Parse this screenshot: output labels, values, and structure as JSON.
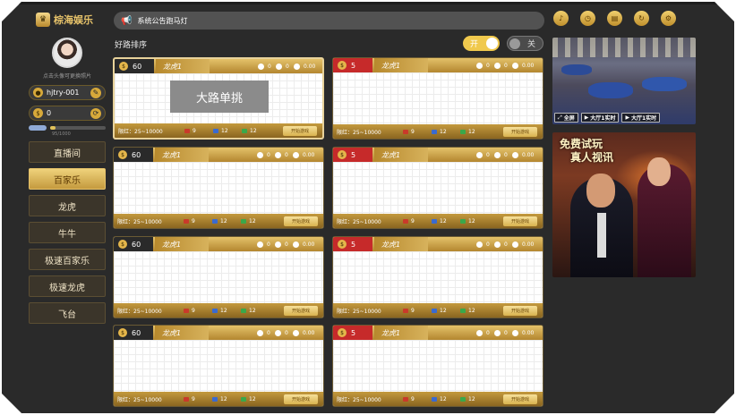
{
  "brand": {
    "logo_glyph": "♛",
    "name": "棕海娱乐"
  },
  "profile": {
    "avatar_hint": "点击头像可更换照片",
    "username": "hjtry-001",
    "balance": "0",
    "xp_text": "95/1000",
    "xp_fraction": 0.095
  },
  "nav": [
    {
      "label": "直播间",
      "active": false
    },
    {
      "label": "百家乐",
      "active": true
    },
    {
      "label": "龙虎",
      "active": false
    },
    {
      "label": "牛牛",
      "active": false
    },
    {
      "label": "极速百家乐",
      "active": false
    },
    {
      "label": "极速龙虎",
      "active": false
    },
    {
      "label": "飞台",
      "active": false
    }
  ],
  "marquee": {
    "text": "系统公告跑马灯",
    "icon": "megaphone-icon"
  },
  "toolbar": {
    "icons": [
      "volume-icon",
      "clock-icon",
      "document-icon",
      "refresh-icon",
      "settings-icon"
    ]
  },
  "sort": {
    "title": "好路排序",
    "on_label": "开",
    "off_label": "关"
  },
  "cards": [
    {
      "room_no": "60",
      "room_style": "dark",
      "game": "龙虎1",
      "players": "0",
      "bets": "0",
      "amount": "0.00",
      "limit": "限红：25~10000",
      "dragon": "9",
      "tie": "12",
      "tiger": "12",
      "start": "开始游戏",
      "selected": true,
      "overlay": "大路单挑"
    },
    {
      "room_no": "5",
      "room_style": "red",
      "game": "龙虎1",
      "players": "0",
      "bets": "0",
      "amount": "0.00",
      "limit": "限红：25~10000",
      "dragon": "9",
      "tie": "12",
      "tiger": "12",
      "start": "开始游戏",
      "selected": false,
      "overlay": ""
    },
    {
      "room_no": "60",
      "room_style": "dark",
      "game": "龙虎1",
      "players": "0",
      "bets": "0",
      "amount": "0.00",
      "limit": "限红：25~10000",
      "dragon": "9",
      "tie": "12",
      "tiger": "12",
      "start": "开始游戏",
      "selected": false,
      "overlay": ""
    },
    {
      "room_no": "5",
      "room_style": "red",
      "game": "龙虎1",
      "players": "0",
      "bets": "0",
      "amount": "0.00",
      "limit": "限红：25~10000",
      "dragon": "9",
      "tie": "12",
      "tiger": "12",
      "start": "开始游戏",
      "selected": false,
      "overlay": ""
    },
    {
      "room_no": "60",
      "room_style": "dark",
      "game": "龙虎1",
      "players": "0",
      "bets": "0",
      "amount": "0.00",
      "limit": "限红：25~10000",
      "dragon": "9",
      "tie": "12",
      "tiger": "12",
      "start": "开始游戏",
      "selected": false,
      "overlay": ""
    },
    {
      "room_no": "5",
      "room_style": "red",
      "game": "龙虎1",
      "players": "0",
      "bets": "0",
      "amount": "0.00",
      "limit": "限红：25~10000",
      "dragon": "9",
      "tie": "12",
      "tiger": "12",
      "start": "开始游戏",
      "selected": false,
      "overlay": ""
    },
    {
      "room_no": "60",
      "room_style": "dark",
      "game": "龙虎1",
      "players": "0",
      "bets": "0",
      "amount": "0.00",
      "limit": "限红：25~10000",
      "dragon": "9",
      "tie": "12",
      "tiger": "12",
      "start": "开始游戏",
      "selected": false,
      "overlay": ""
    },
    {
      "room_no": "5",
      "room_style": "red",
      "game": "龙虎1",
      "players": "0",
      "bets": "0",
      "amount": "0.00",
      "limit": "限红：25~10000",
      "dragon": "9",
      "tie": "12",
      "tiger": "12",
      "start": "开始游戏",
      "selected": false,
      "overlay": ""
    }
  ],
  "live_panel": {
    "fullscreen": "全屏",
    "hall1": "大厅1实时",
    "hall2": "大厅1实时"
  },
  "promo": {
    "line1": "免费试玩",
    "line2": "真人视讯"
  },
  "colors": {
    "gold": "#e4c26a",
    "red_room": "#c62a2a",
    "dark_bg": "#2a2a2a"
  }
}
